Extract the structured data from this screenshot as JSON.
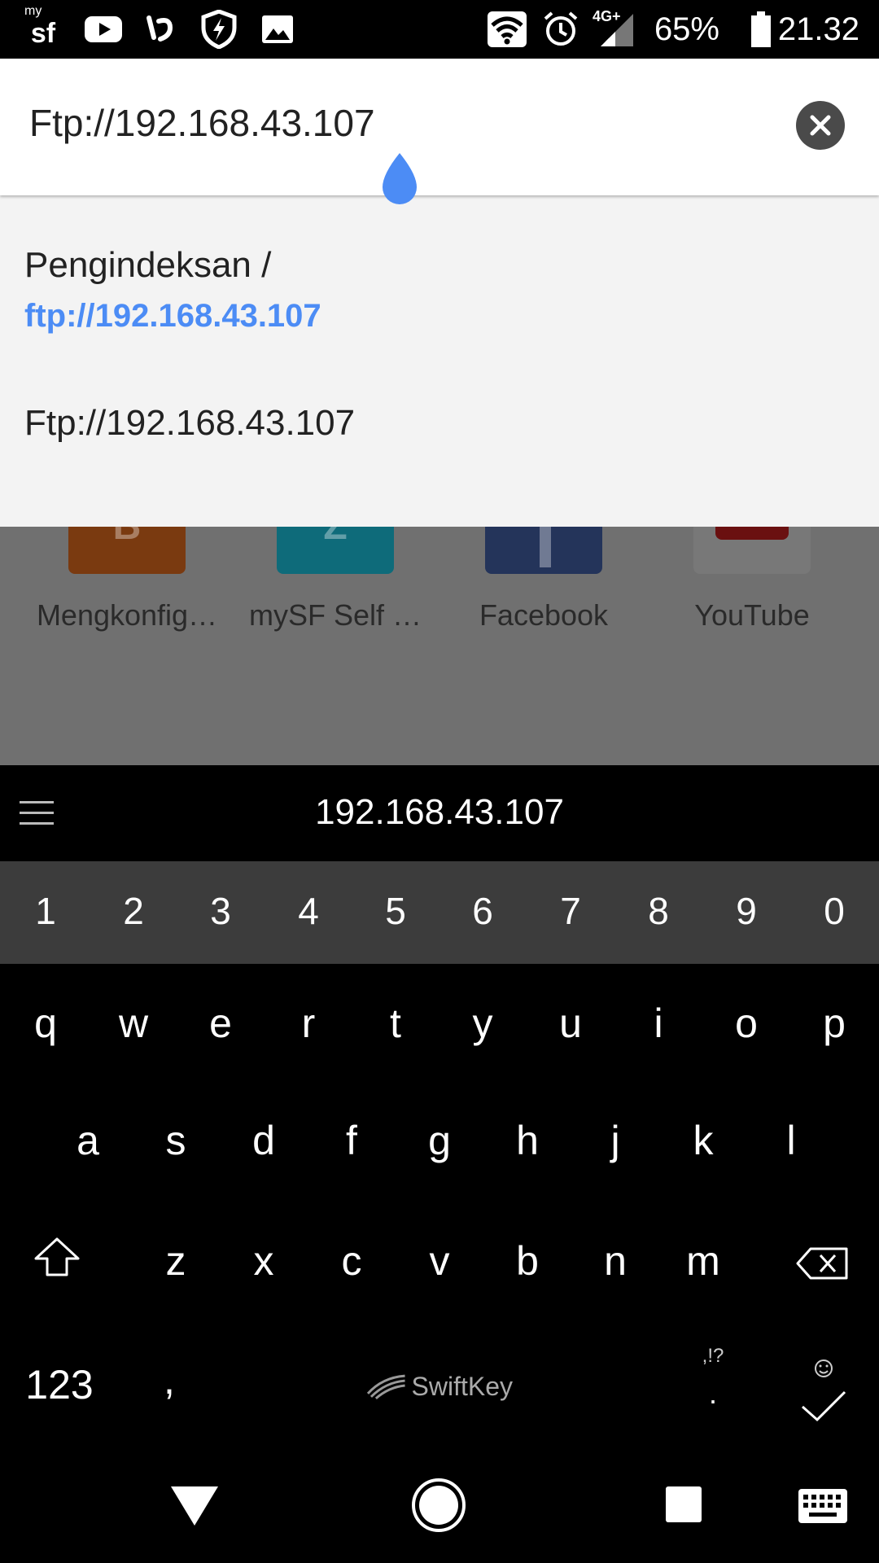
{
  "status_bar": {
    "logo_text": "sf",
    "logo_sup": "my",
    "battery_percent": "65%",
    "time": "21.32",
    "network": "4G+",
    "icons": [
      "mysf-logo",
      "youtube-icon",
      "app-icon",
      "shield-bolt-icon",
      "gallery-icon",
      "wifi-icon",
      "alarm-icon",
      "signal-icon",
      "battery-icon"
    ]
  },
  "url_bar": {
    "value": "Ftp://192.168.43.107"
  },
  "suggestions": [
    {
      "title": "Pengindeksan /",
      "url": "ftp://192.168.43.107"
    },
    {
      "title": "Ftp://192.168.43.107"
    }
  ],
  "speed_dial": [
    {
      "label": "Mengkonfig…",
      "letter": "B",
      "color": "#7a3a10"
    },
    {
      "label": "mySF Self …",
      "letter": "Z",
      "color": "#0e6b7a"
    },
    {
      "label": "Facebook",
      "letter": "f",
      "color": "#24345a"
    },
    {
      "label": "YouTube",
      "letter": "",
      "color": "#6a1010"
    }
  ],
  "keyboard": {
    "prediction": "192.168.43.107",
    "numbers": [
      "1",
      "2",
      "3",
      "4",
      "5",
      "6",
      "7",
      "8",
      "9",
      "0"
    ],
    "row1": [
      "q",
      "w",
      "e",
      "r",
      "t",
      "y",
      "u",
      "i",
      "o",
      "p"
    ],
    "row2": [
      "a",
      "s",
      "d",
      "f",
      "g",
      "h",
      "j",
      "k",
      "l"
    ],
    "row3": [
      "z",
      "x",
      "c",
      "v",
      "b",
      "n",
      "m"
    ],
    "key_123": "123",
    "key_comma": ",",
    "key_period": ".",
    "key_punct": ",!?",
    "brand": "SwiftKey"
  },
  "colors": {
    "accent": "#4c8cf5",
    "suggestion_bg": "#f3f3f3",
    "number_row_bg": "#3c3c3c"
  }
}
